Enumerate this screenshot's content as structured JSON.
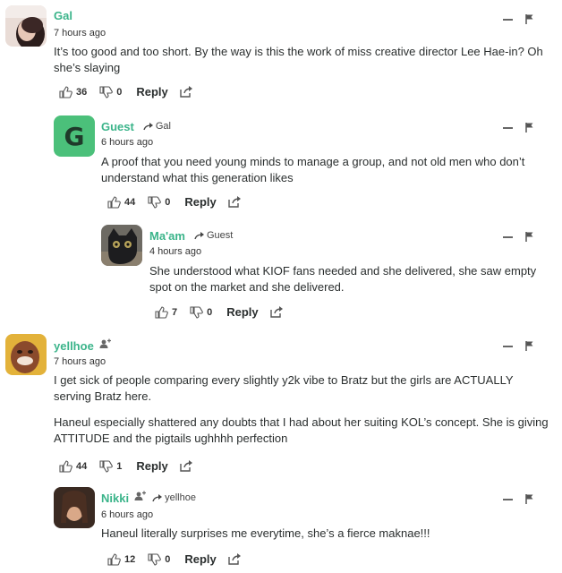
{
  "comments": [
    {
      "author": "Gal",
      "time": "7 hours ago",
      "body": [
        "It’s too good and too short. By the way is this the work of miss creative director Lee Hae-in? Oh she’s slaying"
      ],
      "upvotes": "36",
      "downvotes": "0",
      "reply_label": "Reply",
      "avatar": "photo-avatar"
    },
    {
      "author": "Guest",
      "reply_to": "Gal",
      "time": "6 hours ago",
      "body": [
        "A proof that you need young minds to manage a group, and not old men who don’t understand what this generation likes"
      ],
      "upvotes": "44",
      "downvotes": "0",
      "reply_label": "Reply",
      "avatar_letter": "G",
      "avatar_color": "#4bc07a"
    },
    {
      "author": "Ma'am",
      "reply_to": "Guest",
      "time": "4 hours ago",
      "body": [
        "She understood what KIOF fans needed and she delivered, she saw empty spot on the market and she delivered."
      ],
      "upvotes": "7",
      "downvotes": "0",
      "reply_label": "Reply",
      "avatar": "cat-photo-avatar"
    },
    {
      "author": "yellhoe",
      "time": "7 hours ago",
      "body": [
        "I get sick of people comparing every slightly y2k vibe to Bratz but the girls are ACTUALLY serving Bratz here.",
        "Haneul especially shattered any doubts that I had about her suiting KOL’s concept. She is giving ATTITUDE and the pigtails ughhhh perfection"
      ],
      "upvotes": "44",
      "downvotes": "1",
      "reply_label": "Reply",
      "avatar": "photo-avatar"
    },
    {
      "author": "Nikki",
      "reply_to": "yellhoe",
      "time": "6 hours ago",
      "body": [
        "Haneul literally surprises me everytime, she’s a fierce maknae!!!"
      ],
      "upvotes": "12",
      "downvotes": "0",
      "reply_label": "Reply",
      "avatar": "photo-avatar"
    }
  ],
  "colors": {
    "author": "#3bb48a",
    "text": "#2a2e2e",
    "icon": "#555555"
  },
  "icons": [
    "thumbs-up-icon",
    "thumbs-down-icon",
    "share-icon",
    "minimize-icon",
    "flag-icon",
    "reply-arrow-icon",
    "follow-user-icon"
  ]
}
